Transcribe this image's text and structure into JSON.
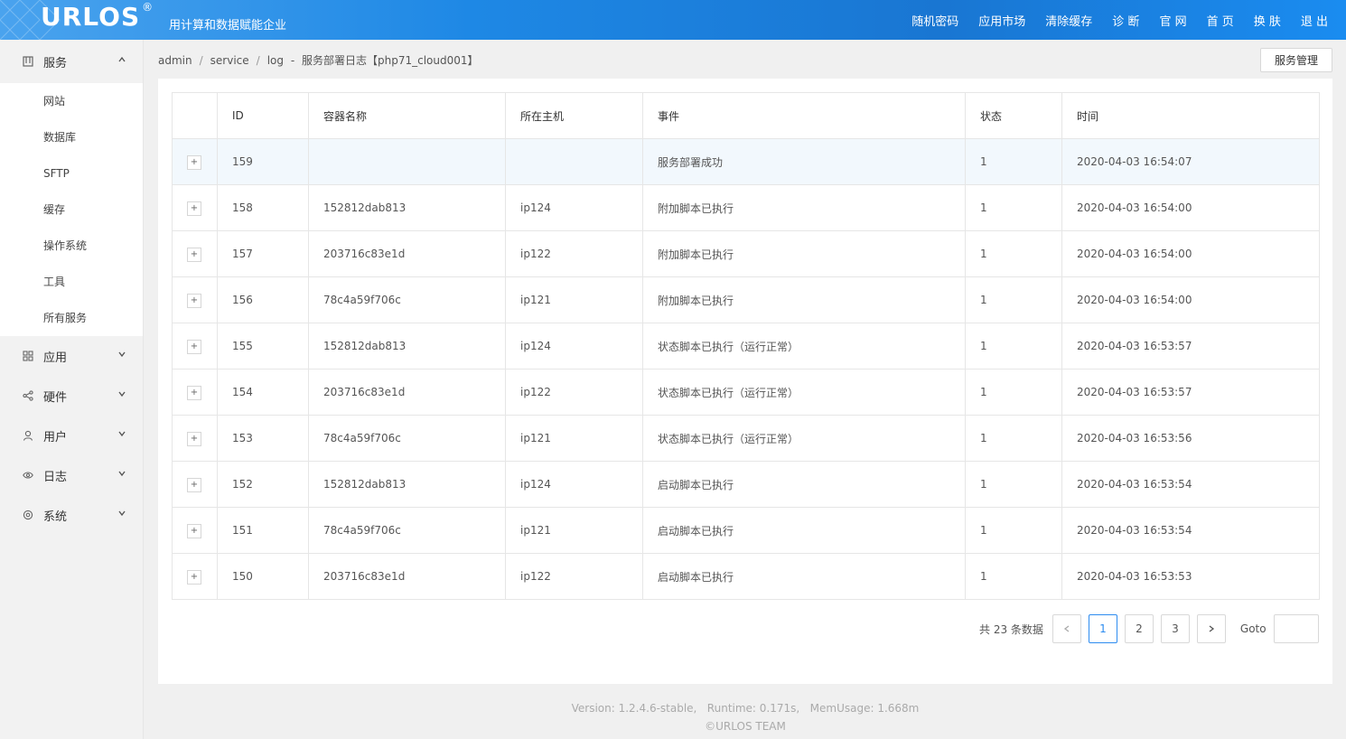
{
  "header": {
    "brand": "URLOS",
    "brand_mark": "®",
    "slogan": "用计算和数据赋能企业",
    "nav": [
      "随机密码",
      "应用市场",
      "清除缓存",
      "诊 断",
      "官 网",
      "首 页",
      "换 肤",
      "退 出"
    ]
  },
  "sidebar": {
    "service": {
      "label": "服务",
      "items": [
        "网站",
        "数据库",
        "SFTP",
        "缓存",
        "操作系统",
        "工具",
        "所有服务"
      ]
    },
    "groups": [
      {
        "label": "应用",
        "icon": "grid-icon"
      },
      {
        "label": "硬件",
        "icon": "share-icon"
      },
      {
        "label": "用户",
        "icon": "user-icon"
      },
      {
        "label": "日志",
        "icon": "eye-icon"
      },
      {
        "label": "系统",
        "icon": "gear-icon"
      }
    ]
  },
  "breadcrumb": {
    "items": [
      "admin",
      "service",
      "log"
    ],
    "title": "服务部署日志【php71_cloud001】",
    "dash": "-"
  },
  "toolbar": {
    "service_manage": "服务管理"
  },
  "table": {
    "columns": [
      "",
      "ID",
      "容器名称",
      "所在主机",
      "事件",
      "状态",
      "时间"
    ],
    "rows": [
      [
        "+",
        "159",
        "",
        "",
        "服务部署成功",
        "1",
        "2020-04-03 16:54:07"
      ],
      [
        "+",
        "158",
        "152812dab813",
        "ip124",
        "附加脚本已执行",
        "1",
        "2020-04-03 16:54:00"
      ],
      [
        "+",
        "157",
        "203716c83e1d",
        "ip122",
        "附加脚本已执行",
        "1",
        "2020-04-03 16:54:00"
      ],
      [
        "+",
        "156",
        "78c4a59f706c",
        "ip121",
        "附加脚本已执行",
        "1",
        "2020-04-03 16:54:00"
      ],
      [
        "+",
        "155",
        "152812dab813",
        "ip124",
        "状态脚本已执行（运行正常）",
        "1",
        "2020-04-03 16:53:57"
      ],
      [
        "+",
        "154",
        "203716c83e1d",
        "ip122",
        "状态脚本已执行（运行正常）",
        "1",
        "2020-04-03 16:53:57"
      ],
      [
        "+",
        "153",
        "78c4a59f706c",
        "ip121",
        "状态脚本已执行（运行正常）",
        "1",
        "2020-04-03 16:53:56"
      ],
      [
        "+",
        "152",
        "152812dab813",
        "ip124",
        "启动脚本已执行",
        "1",
        "2020-04-03 16:53:54"
      ],
      [
        "+",
        "151",
        "78c4a59f706c",
        "ip121",
        "启动脚本已执行",
        "1",
        "2020-04-03 16:53:54"
      ],
      [
        "+",
        "150",
        "203716c83e1d",
        "ip122",
        "启动脚本已执行",
        "1",
        "2020-04-03 16:53:53"
      ]
    ]
  },
  "pager": {
    "total": "共 23 条数据",
    "prev": "‹",
    "pages": [
      "1",
      "2",
      "3"
    ],
    "current": "1",
    "next": "›",
    "goto_label": "Goto",
    "goto_value": ""
  },
  "footer": {
    "line1": "Version: 1.2.4.6-stable,   Runtime: 0.171s,   MemUsage: 1.668m",
    "line2": "©URLOS TEAM"
  },
  "colors": {
    "header": "#1e88e5",
    "accent": "#2d8cf0",
    "row_highlight": "#f2f8fd"
  }
}
